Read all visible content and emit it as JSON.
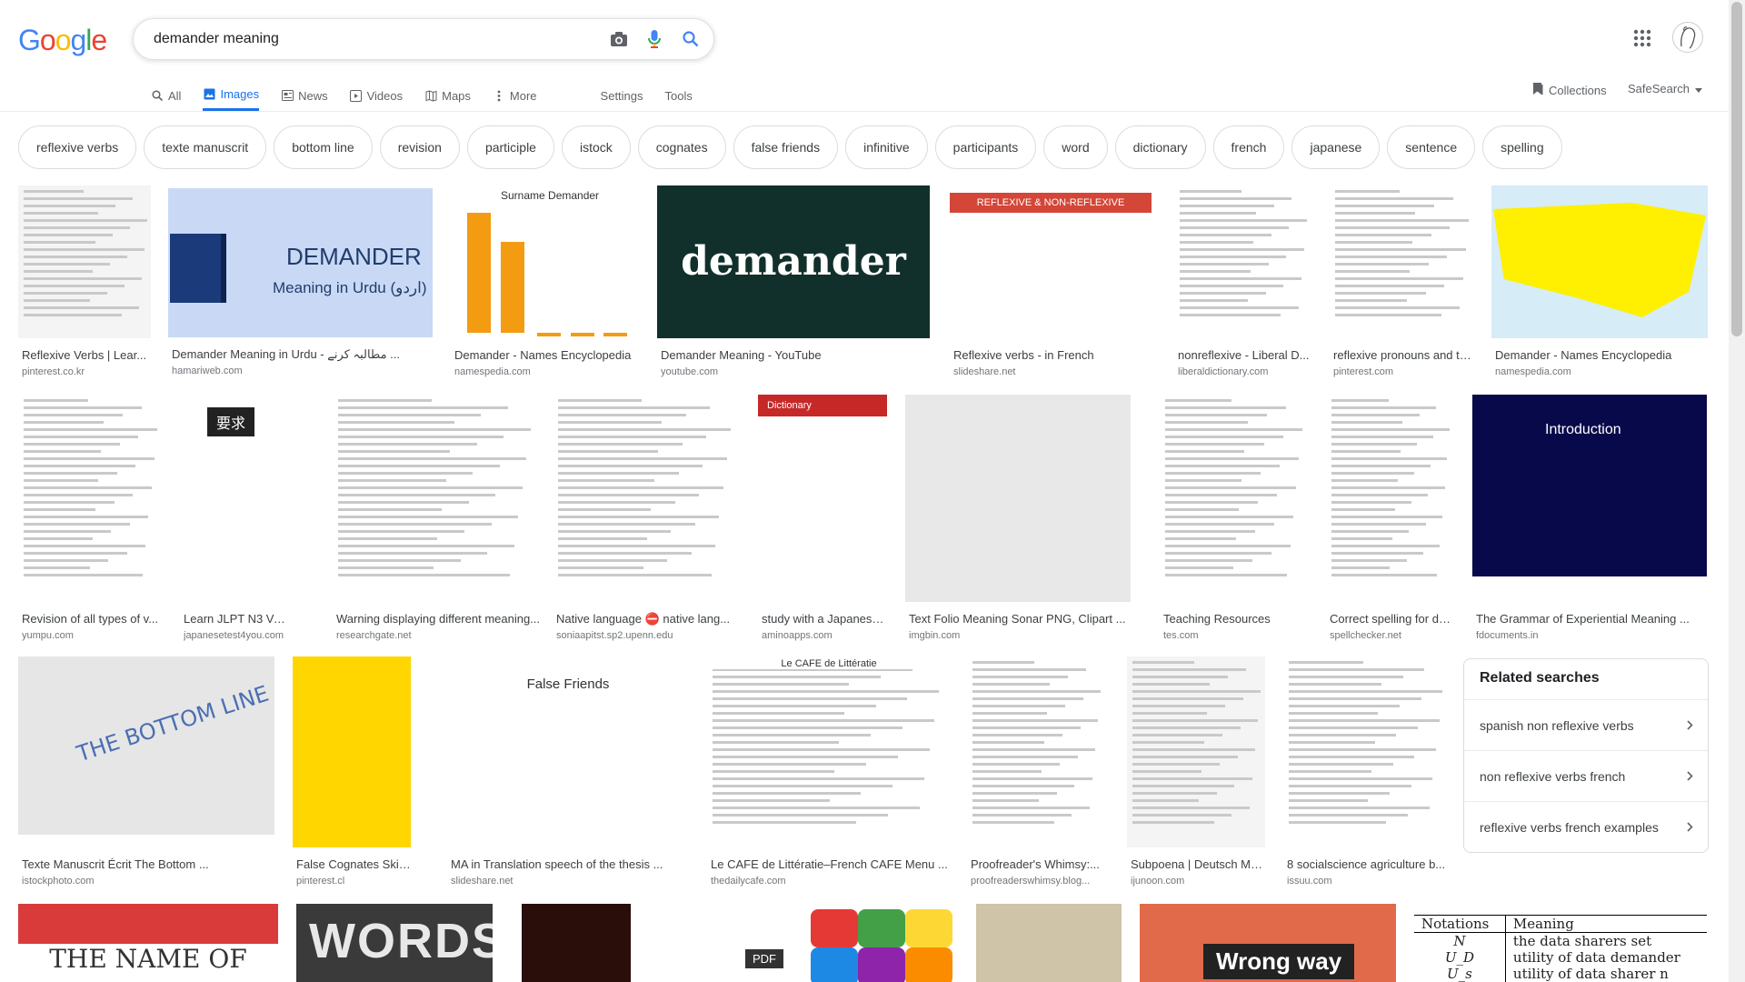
{
  "search": {
    "query": "demander meaning"
  },
  "logo": {
    "letters": [
      "G",
      "o",
      "o",
      "g",
      "l",
      "e"
    ],
    "colors": [
      "#4285f4",
      "#ea4335",
      "#fbbc05",
      "#4285f4",
      "#34a853",
      "#ea4335"
    ]
  },
  "tabs": [
    {
      "label": "All",
      "icon": "search-icon"
    },
    {
      "label": "Images",
      "icon": "image-icon",
      "active": true
    },
    {
      "label": "News",
      "icon": "news-icon"
    },
    {
      "label": "Videos",
      "icon": "video-icon"
    },
    {
      "label": "Maps",
      "icon": "map-icon"
    },
    {
      "label": "More",
      "icon": "more-icon"
    }
  ],
  "tools": {
    "settings": "Settings",
    "tools": "Tools",
    "collections": "Collections",
    "safesearch": "SafeSearch"
  },
  "chips": [
    "reflexive verbs",
    "texte manuscrit",
    "bottom line",
    "revision",
    "participle",
    "istock",
    "cognates",
    "false friends",
    "infinitive",
    "participants",
    "word",
    "dictionary",
    "french",
    "japanese",
    "sentence",
    "spelling"
  ],
  "results": [
    {
      "title": "Reflexive Verbs | Lear...",
      "source": "pinterest.co.kr"
    },
    {
      "title": "Demander Meaning in Urdu - مطالبہ کرنے ...",
      "source": "hamariweb.com",
      "thumb_title": "DEMANDER",
      "thumb_sub": "Meaning in Urdu (اردو)"
    },
    {
      "title": "Demander - Names Encyclopedia",
      "source": "namespedia.com",
      "thumb_title": "Surname Demander"
    },
    {
      "title": "Demander Meaning - YouTube",
      "source": "youtube.com",
      "thumb_title": "demander"
    },
    {
      "title": "Reflexive verbs - in French",
      "source": "slideshare.net",
      "thumb_title": "REFLEXIVE & NON-REFLEXIVE"
    },
    {
      "title": "nonreflexive - Liberal D...",
      "source": "liberaldictionary.com"
    },
    {
      "title": "reflexive pronouns and th...",
      "source": "pinterest.com"
    },
    {
      "title": "Demander - Names Encyclopedia",
      "source": "namespedia.com"
    },
    {
      "title": "Revision of all types of v...",
      "source": "yumpu.com"
    },
    {
      "title": "Learn JLPT N3 Vocab...",
      "source": "japanesetest4you.com",
      "thumb_title": "要求"
    },
    {
      "title": "Warning displaying different meaning...",
      "source": "researchgate.net"
    },
    {
      "title": "Native language ⛔ native lang...",
      "source": "soniaapitst.sp2.upenn.edu"
    },
    {
      "title": "study with a Japanese...",
      "source": "aminoapps.com",
      "thumb_title": "Dictionary"
    },
    {
      "title": "Text Folio Meaning Sonar PNG, Clipart ...",
      "source": "imgbin.com"
    },
    {
      "title": "Teaching Resources",
      "source": "tes.com"
    },
    {
      "title": "Correct spelling for de...",
      "source": "spellchecker.net"
    },
    {
      "title": "The Grammar of Experiential Meaning ...",
      "source": "fdocuments.in",
      "thumb_title": "Introduction"
    },
    {
      "title": "Texte Manuscrit Écrit The Bottom ...",
      "source": "istockphoto.com",
      "thumb_title": "THE BOTTOM LINE"
    },
    {
      "title": "False Cognates Skinny...",
      "source": "pinterest.cl"
    },
    {
      "title": "MA in Translation speech of the thesis ...",
      "source": "slideshare.net",
      "thumb_title": "False Friends"
    },
    {
      "title": "Le CAFE de Littératie–French CAFE Menu ...",
      "source": "thedailycafe.com",
      "thumb_title": "Le CAFE de Littératie"
    },
    {
      "title": "Proofreader's Whimsy:...",
      "source": "proofreaderswhimsy.blog..."
    },
    {
      "title": "Subpoena | Deutsch Me...",
      "source": "ijunoon.com"
    },
    {
      "title": "8 socialscience agriculture b...",
      "source": "issuu.com"
    }
  ],
  "row4": {
    "name_of": "THE NAME OF",
    "words": "WORDS",
    "pdf": "PDF",
    "wrong_way": "Wrong way",
    "table_head": [
      "Notations",
      "Meaning"
    ],
    "table_rows": [
      [
        "N",
        "the data sharers set"
      ],
      [
        "U_D",
        "utility of data demander"
      ],
      [
        "U_s",
        "utility of data sharer n"
      ]
    ]
  },
  "related": {
    "heading": "Related searches",
    "items": [
      "spanish non reflexive verbs",
      "non reflexive verbs french",
      "reflexive verbs french examples"
    ]
  }
}
